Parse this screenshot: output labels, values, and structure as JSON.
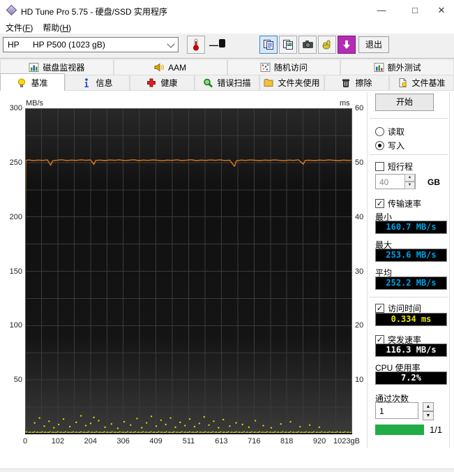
{
  "titlebar": {
    "title": "HD Tune Pro 5.75 - 硬盘/SSD 实用程序"
  },
  "menu": {
    "items": [
      "文件(F)",
      "帮助(H)"
    ]
  },
  "toolbar": {
    "drive_short": "HP",
    "drive_model": "HP P500 (1023 gB)",
    "temperature": "—",
    "exit_label": "退出",
    "icons": [
      "thermometer-icon",
      "copy-report-icon",
      "copy-image-icon",
      "camera-icon",
      "donate-icon",
      "update-icon"
    ],
    "selected_button": "copy-report",
    "update_button_color": "#b42cb4"
  },
  "tabs": {
    "row1": [
      {
        "name": "tab-disk-monitor",
        "label": "磁盘监视器",
        "icon": "disk-monitor-icon"
      },
      {
        "name": "tab-aam",
        "label": "AAM",
        "icon": "speaker-icon"
      },
      {
        "name": "tab-random-access",
        "label": "随机访问",
        "icon": "random-access-icon"
      },
      {
        "name": "tab-extra-tests",
        "label": "额外测试",
        "icon": "extra-tests-icon"
      }
    ],
    "row2": [
      {
        "name": "tab-benchmark",
        "label": "基准",
        "icon": "benchmark-icon",
        "active": true
      },
      {
        "name": "tab-info",
        "label": "信息",
        "icon": "info-icon"
      },
      {
        "name": "tab-health",
        "label": "健康",
        "icon": "health-icon"
      },
      {
        "name": "tab-error-scan",
        "label": "错误扫描",
        "icon": "error-scan-icon"
      },
      {
        "name": "tab-folder-usage",
        "label": "文件夹使用",
        "icon": "folder-usage-icon"
      },
      {
        "name": "tab-erase",
        "label": "擦除",
        "icon": "erase-icon"
      },
      {
        "name": "tab-file-benchmark",
        "label": "文件基准",
        "icon": "file-benchmark-icon"
      }
    ]
  },
  "panel": {
    "start_label": "开始",
    "radio_read": "读取",
    "radio_write": "写入",
    "write_selected": true,
    "short_stroke_label": "短行程",
    "short_stroke_checked": false,
    "short_stroke_value": "40",
    "short_stroke_unit": "GB",
    "transfer_rate_label": "传输速率",
    "transfer_rate_checked": true,
    "min_label": "最小",
    "min_value": "160.7 MB/s",
    "max_label": "最大",
    "max_value": "253.6 MB/s",
    "avg_label": "平均",
    "avg_value": "252.2 MB/s",
    "access_time_label": "访问时间",
    "access_time_checked": true,
    "access_time_value": "0.334 ms",
    "burst_rate_label": "突发速率",
    "burst_rate_checked": true,
    "burst_rate_value": "116.3 MB/s",
    "cpu_label": "CPU 使用率",
    "cpu_value": "7.2%",
    "pass_count_label": "通过次数",
    "pass_count_value": "1",
    "progress_label": "1/1",
    "progress_percent": 100,
    "value_colors": {
      "transfer": "#00a2e8",
      "access": "#e8e800",
      "burst": "#ffffff",
      "cpu": "#ffffff",
      "progress": "#22ac46"
    }
  },
  "chart_data": {
    "type": "line+scatter",
    "x_axis": {
      "range": [
        0,
        1023
      ],
      "tick_labels": [
        "0",
        "102",
        "204",
        "306",
        "409",
        "511",
        "613",
        "716",
        "818",
        "920",
        "1023gB"
      ]
    },
    "y_left": {
      "label": "MB/s",
      "range": [
        0,
        300
      ],
      "tick_labels": [
        300,
        250,
        200,
        150,
        100,
        50
      ]
    },
    "y_right": {
      "label": "ms",
      "range": [
        0,
        60
      ],
      "tick_labels": [
        60,
        50,
        40,
        30,
        20,
        10
      ]
    },
    "grid": {
      "v_cells": 20,
      "h_cells": 12
    },
    "series": [
      {
        "name": "写入传输速率",
        "type": "line",
        "axis": "left",
        "units": "MB/s",
        "color": "#e07818",
        "points": [
          [
            0,
            160.7
          ],
          [
            2,
            252.0
          ],
          [
            12,
            252.4
          ],
          [
            25,
            251.8
          ],
          [
            40,
            252.3
          ],
          [
            55,
            252.0
          ],
          [
            70,
            252.4
          ],
          [
            80,
            247.5
          ],
          [
            86,
            251.6
          ],
          [
            100,
            252.2
          ],
          [
            115,
            252.6
          ],
          [
            130,
            251.9
          ],
          [
            145,
            252.3
          ],
          [
            160,
            252.0
          ],
          [
            175,
            252.5
          ],
          [
            190,
            252.1
          ],
          [
            205,
            252.4
          ],
          [
            215,
            248.2
          ],
          [
            221,
            252.0
          ],
          [
            235,
            252.3
          ],
          [
            250,
            251.8
          ],
          [
            265,
            252.4
          ],
          [
            280,
            252.1
          ],
          [
            295,
            252.5
          ],
          [
            310,
            251.9
          ],
          [
            325,
            252.2
          ],
          [
            340,
            252.6
          ],
          [
            355,
            251.8
          ],
          [
            370,
            252.3
          ],
          [
            385,
            252.0
          ],
          [
            400,
            252.4
          ],
          [
            415,
            252.1
          ],
          [
            430,
            251.7
          ],
          [
            445,
            252.3
          ],
          [
            460,
            252.0
          ],
          [
            475,
            252.5
          ],
          [
            490,
            251.9
          ],
          [
            505,
            252.2
          ],
          [
            520,
            252.6
          ],
          [
            535,
            251.8
          ],
          [
            550,
            252.3
          ],
          [
            565,
            252.0
          ],
          [
            580,
            252.4
          ],
          [
            595,
            252.1
          ],
          [
            610,
            252.5
          ],
          [
            625,
            251.9
          ],
          [
            640,
            252.2
          ],
          [
            655,
            246.5
          ],
          [
            661,
            251.6
          ],
          [
            675,
            252.3
          ],
          [
            690,
            252.0
          ],
          [
            705,
            252.4
          ],
          [
            720,
            252.1
          ],
          [
            735,
            251.8
          ],
          [
            750,
            252.3
          ],
          [
            765,
            252.0
          ],
          [
            780,
            252.4
          ],
          [
            795,
            252.1
          ],
          [
            810,
            251.7
          ],
          [
            825,
            252.3
          ],
          [
            840,
            252.0
          ],
          [
            855,
            252.5
          ],
          [
            870,
            248.5
          ],
          [
            876,
            252.0
          ],
          [
            890,
            252.2
          ],
          [
            905,
            251.8
          ],
          [
            920,
            252.3
          ],
          [
            935,
            252.0
          ],
          [
            950,
            252.4
          ],
          [
            965,
            252.1
          ],
          [
            980,
            251.8
          ],
          [
            995,
            252.3
          ],
          [
            1010,
            252.0
          ],
          [
            1023,
            252.2
          ]
        ]
      },
      {
        "name": "访问时间",
        "type": "scatter",
        "axis": "right",
        "units": "ms",
        "color": "#d8d800",
        "baseline_band": {
          "y_ms": 0.33,
          "x_range": [
            0,
            1023
          ]
        },
        "points": [
          [
            30,
            2.1
          ],
          [
            45,
            3.0
          ],
          [
            60,
            1.5
          ],
          [
            75,
            2.4
          ],
          [
            90,
            1.2
          ],
          [
            105,
            1.8
          ],
          [
            120,
            2.8
          ],
          [
            140,
            1.4
          ],
          [
            160,
            2.2
          ],
          [
            175,
            3.4
          ],
          [
            190,
            1.6
          ],
          [
            205,
            2.0
          ],
          [
            215,
            3.1
          ],
          [
            230,
            2.5
          ],
          [
            250,
            1.3
          ],
          [
            270,
            1.9
          ],
          [
            290,
            1.1
          ],
          [
            310,
            2.3
          ],
          [
            330,
            1.7
          ],
          [
            350,
            2.9
          ],
          [
            365,
            1.2
          ],
          [
            380,
            2.1
          ],
          [
            395,
            3.3
          ],
          [
            410,
            1.5
          ],
          [
            425,
            2.6
          ],
          [
            440,
            1.8
          ],
          [
            455,
            3.0
          ],
          [
            470,
            1.3
          ],
          [
            485,
            2.2
          ],
          [
            500,
            1.6
          ],
          [
            515,
            2.8
          ],
          [
            530,
            1.4
          ],
          [
            545,
            2.0
          ],
          [
            560,
            3.2
          ],
          [
            575,
            1.7
          ],
          [
            590,
            2.4
          ],
          [
            605,
            1.2
          ],
          [
            620,
            2.7
          ],
          [
            640,
            1.5
          ],
          [
            660,
            2.1
          ],
          [
            680,
            1.8
          ],
          [
            700,
            1.3
          ],
          [
            720,
            2.5
          ],
          [
            745,
            1.6
          ],
          [
            770,
            1.2
          ],
          [
            800,
            1.9
          ],
          [
            830,
            2.3
          ],
          [
            860,
            1.4
          ],
          [
            890,
            1.7
          ],
          [
            920,
            1.3
          ]
        ]
      }
    ]
  }
}
